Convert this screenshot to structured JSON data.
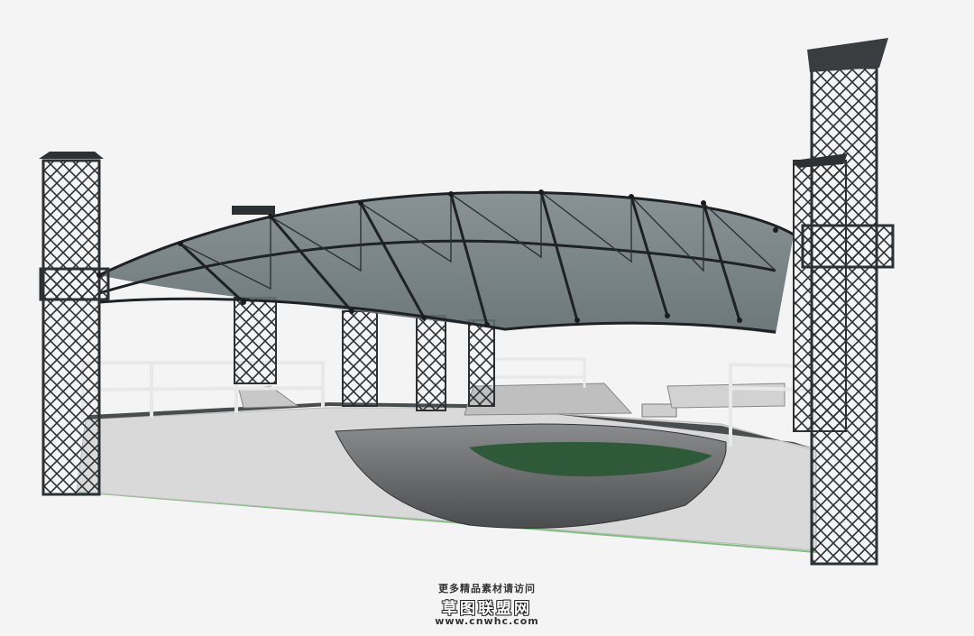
{
  "watermark": {
    "line1": "更多精品素材请访问",
    "line2": "草图联盟网",
    "line3": "www.cnwhc.com"
  },
  "colors": {
    "background": "#f4f4f4",
    "steel": "#2e3133",
    "roof_glass": "#6f7b7f",
    "wall": "#d9d9d9",
    "bowl": "#5c5f60",
    "bowl_floor": "#2f5a3a",
    "ground_line": "#7fbf7f",
    "railing": "#e8e8e8"
  }
}
